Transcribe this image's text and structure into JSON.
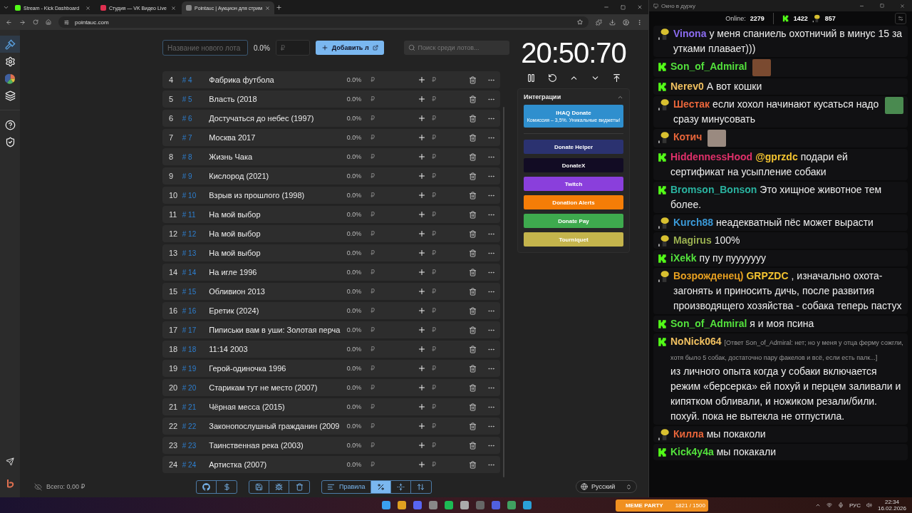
{
  "browser": {
    "tabs": [
      {
        "title": "Stream - Kick Dashboard",
        "kind": "kick",
        "selected": false
      },
      {
        "title": "Студия — VK Видео Live",
        "kind": "vk",
        "selected": false
      },
      {
        "title": "Pointauc | Аукцион для стрим",
        "kind": "pointauc",
        "selected": true
      }
    ],
    "url": "pointauc.com"
  },
  "sidebar": {
    "items": [
      {
        "kind": "gavel",
        "selected": true
      },
      {
        "kind": "settings",
        "selected": false
      },
      {
        "kind": "stats",
        "selected": false
      },
      {
        "kind": "layers",
        "selected": false
      },
      {
        "kind": "help",
        "selected": false
      },
      {
        "kind": "shield",
        "selected": false
      }
    ]
  },
  "toolbar": {
    "name_placeholder": "Название нового лота",
    "percent": "0.0%",
    "amount_placeholder": "₽",
    "add_label": "Добавить л",
    "search_placeholder": "Поиск среди лотов..."
  },
  "lots": [
    {
      "index": "4",
      "id": "# 4",
      "name": "Фабрика футбола",
      "percent": "0.0%",
      "amount": "₽",
      "bid": "₽"
    },
    {
      "index": "5",
      "id": "# 5",
      "name": "Власть (2018",
      "percent": "0.0%",
      "amount": "₽",
      "bid": "₽"
    },
    {
      "index": "6",
      "id": "# 6",
      "name": "Достучаться до небес (1997)",
      "percent": "0.0%",
      "amount": "₽",
      "bid": "₽"
    },
    {
      "index": "7",
      "id": "# 7",
      "name": "Москва 2017",
      "percent": "0.0%",
      "amount": "₽",
      "bid": "₽"
    },
    {
      "index": "8",
      "id": "# 8",
      "name": "Жизнь Чака",
      "percent": "0.0%",
      "amount": "₽",
      "bid": "₽"
    },
    {
      "index": "9",
      "id": "# 9",
      "name": "Кислород (2021)",
      "percent": "0.0%",
      "amount": "₽",
      "bid": "₽"
    },
    {
      "index": "10",
      "id": "# 10",
      "name": "Взрыв из прошлого (1998)",
      "percent": "0.0%",
      "amount": "₽",
      "bid": "₽"
    },
    {
      "index": "11",
      "id": "# 11",
      "name": "На мой выбор",
      "percent": "0.0%",
      "amount": "₽",
      "bid": "₽"
    },
    {
      "index": "12",
      "id": "# 12",
      "name": "На мой выбор",
      "percent": "0.0%",
      "amount": "₽",
      "bid": "₽"
    },
    {
      "index": "13",
      "id": "# 13",
      "name": "На мой выбор",
      "percent": "0.0%",
      "amount": "₽",
      "bid": "₽"
    },
    {
      "index": "14",
      "id": "# 14",
      "name": "На игле 1996",
      "percent": "0.0%",
      "amount": "₽",
      "bid": "₽"
    },
    {
      "index": "15",
      "id": "# 15",
      "name": "Обливион 2013",
      "percent": "0.0%",
      "amount": "₽",
      "bid": "₽"
    },
    {
      "index": "16",
      "id": "# 16",
      "name": "Еретик (2024)",
      "percent": "0.0%",
      "amount": "₽",
      "bid": "₽"
    },
    {
      "index": "17",
      "id": "# 17",
      "name": "Пиписьки вам в уши: Золотая перча",
      "percent": "0.0%",
      "amount": "₽",
      "bid": "₽"
    },
    {
      "index": "18",
      "id": "# 18",
      "name": "11:14 2003",
      "percent": "0.0%",
      "amount": "₽",
      "bid": "₽"
    },
    {
      "index": "19",
      "id": "# 19",
      "name": "Герой-одиночка 1996",
      "percent": "0.0%",
      "amount": "₽",
      "bid": "₽"
    },
    {
      "index": "20",
      "id": "# 20",
      "name": "Старикам тут не место (2007)",
      "percent": "0.0%",
      "amount": "₽",
      "bid": "₽"
    },
    {
      "index": "21",
      "id": "# 21",
      "name": "Чёрная месса (2015)",
      "percent": "0.0%",
      "amount": "₽",
      "bid": "₽"
    },
    {
      "index": "22",
      "id": "# 22",
      "name": "Законопослушный гражданин (2009",
      "percent": "0.0%",
      "amount": "₽",
      "bid": "₽"
    },
    {
      "index": "23",
      "id": "# 23",
      "name": "Таинственная река (2003)",
      "percent": "0.0%",
      "amount": "₽",
      "bid": "₽"
    },
    {
      "index": "24",
      "id": "# 24",
      "name": "Артистка (2007)",
      "percent": "0.0%",
      "amount": "₽",
      "bid": "₽"
    }
  ],
  "timer": "20:50:70",
  "integrations": {
    "title": "Интеграции",
    "expanded": true,
    "services": [
      {
        "name": "IHAQ Donate",
        "subtitle": "Комиссия – 3,5%. Уникальные виджеты!",
        "color": "#2f8fce"
      },
      {
        "name": "Donate Helper",
        "color": "#2b3270"
      },
      {
        "name": "DonateX",
        "color": "#120c24"
      },
      {
        "name": "Twitch",
        "color": "#8a3fdc"
      },
      {
        "name": "Donation Alerts",
        "color": "#f57d07"
      },
      {
        "name": "Donate Pay",
        "color": "#3eaa4e"
      },
      {
        "name": "Tourniquet",
        "color": "#c4b44c"
      }
    ]
  },
  "footer": {
    "total": "Всего: 0,00 ₽",
    "rules_label": "Правила",
    "tools": [
      {
        "kind": "github",
        "selected": false
      },
      {
        "kind": "dollar",
        "selected": false
      },
      {
        "kind": "save",
        "selected": false
      },
      {
        "kind": "bug",
        "selected": false
      },
      {
        "kind": "clear",
        "selected": false
      },
      {
        "kind": "rules",
        "selected": false
      },
      {
        "kind": "percent",
        "selected": true
      },
      {
        "kind": "compress",
        "selected": false
      },
      {
        "kind": "sort",
        "selected": false
      }
    ],
    "language": "Русский"
  },
  "chat": {
    "title": "Окно в дурку",
    "online_label": "Online:",
    "online": "2279",
    "kick_count": "1422",
    "vk_count": "857",
    "messages": [
      {
        "kind": "vk",
        "user": "Vinona",
        "color": "#8b6cf0",
        "text": "у меня спаниель охотничий в минус 15 за утками плавает)))"
      },
      {
        "kind": "kick",
        "user": "Son_of_Admiral",
        "color": "#53e03c",
        "emote": true
      },
      {
        "kind": "kick",
        "user": "Nerev0",
        "color": "#f0c060",
        "text": "А вот кошки"
      },
      {
        "kind": "vk",
        "user": "Шестак",
        "color": "#e8653a",
        "text": "если хохол начинают кусаться надо сразу минусовать",
        "emote": true
      },
      {
        "kind": "vk",
        "user": "Котич",
        "color": "#e8653a",
        "emote": true
      },
      {
        "kind": "kick",
        "user": "HiddennessHood",
        "color": "#e0306a",
        "mention": "@gprzdc",
        "text": "подари ей сертификат на усыпление собаки"
      },
      {
        "kind": "kick",
        "user": "Bromson_Bonson",
        "color": "#2ab3a0",
        "text": "Это хищное животное тем более."
      },
      {
        "kind": "vk",
        "user": "Kurch88",
        "color": "#3b9ad8",
        "text": "неадекватный пёс может вырасти"
      },
      {
        "kind": "vk",
        "user": "Magirus",
        "color": "#9ab050",
        "text": "100%"
      },
      {
        "kind": "kick",
        "user": "iXekk",
        "color": "#53e03c",
        "text": "пу пу пууууууу"
      },
      {
        "kind": "vk",
        "user": "Возрожденец)",
        "color": "#e8a020",
        "mention": "GRPZDC",
        "text": ", изначально охота-загонять и приносить дичь, после развития производящего хозяйства - собака теперь пастух"
      },
      {
        "kind": "kick",
        "user": "Son_of_Admiral",
        "color": "#53e03c",
        "text": "я и моя псина"
      },
      {
        "kind": "kick",
        "user": "NoNick064",
        "color": "#f0c060",
        "reply": "[Ответ Son_of_Admiral: нет; но у меня у отца ферму сожгли, хотя было 5 собак, достаточно пару факелов и всё, если есть палк...]",
        "text": "из личного опыта когда у собаки включается режим «берсерка» ей похуй и перцем заливали и кипятком обливали, и ножиком резали/били. похуй. пока не вытекла не отпустила."
      },
      {
        "kind": "vk",
        "user": "Килла",
        "color": "#e8653a",
        "text": "мы покаколи"
      },
      {
        "kind": "kick",
        "user": "Kick4y4a",
        "color": "#53e03c",
        "text": "мы покакали"
      }
    ]
  },
  "taskbar": {
    "widget_title": "MEME PARTY",
    "widget_count": "1821 / 1500",
    "language": "РУС",
    "time": "22:34",
    "date": "16.02.2026"
  }
}
